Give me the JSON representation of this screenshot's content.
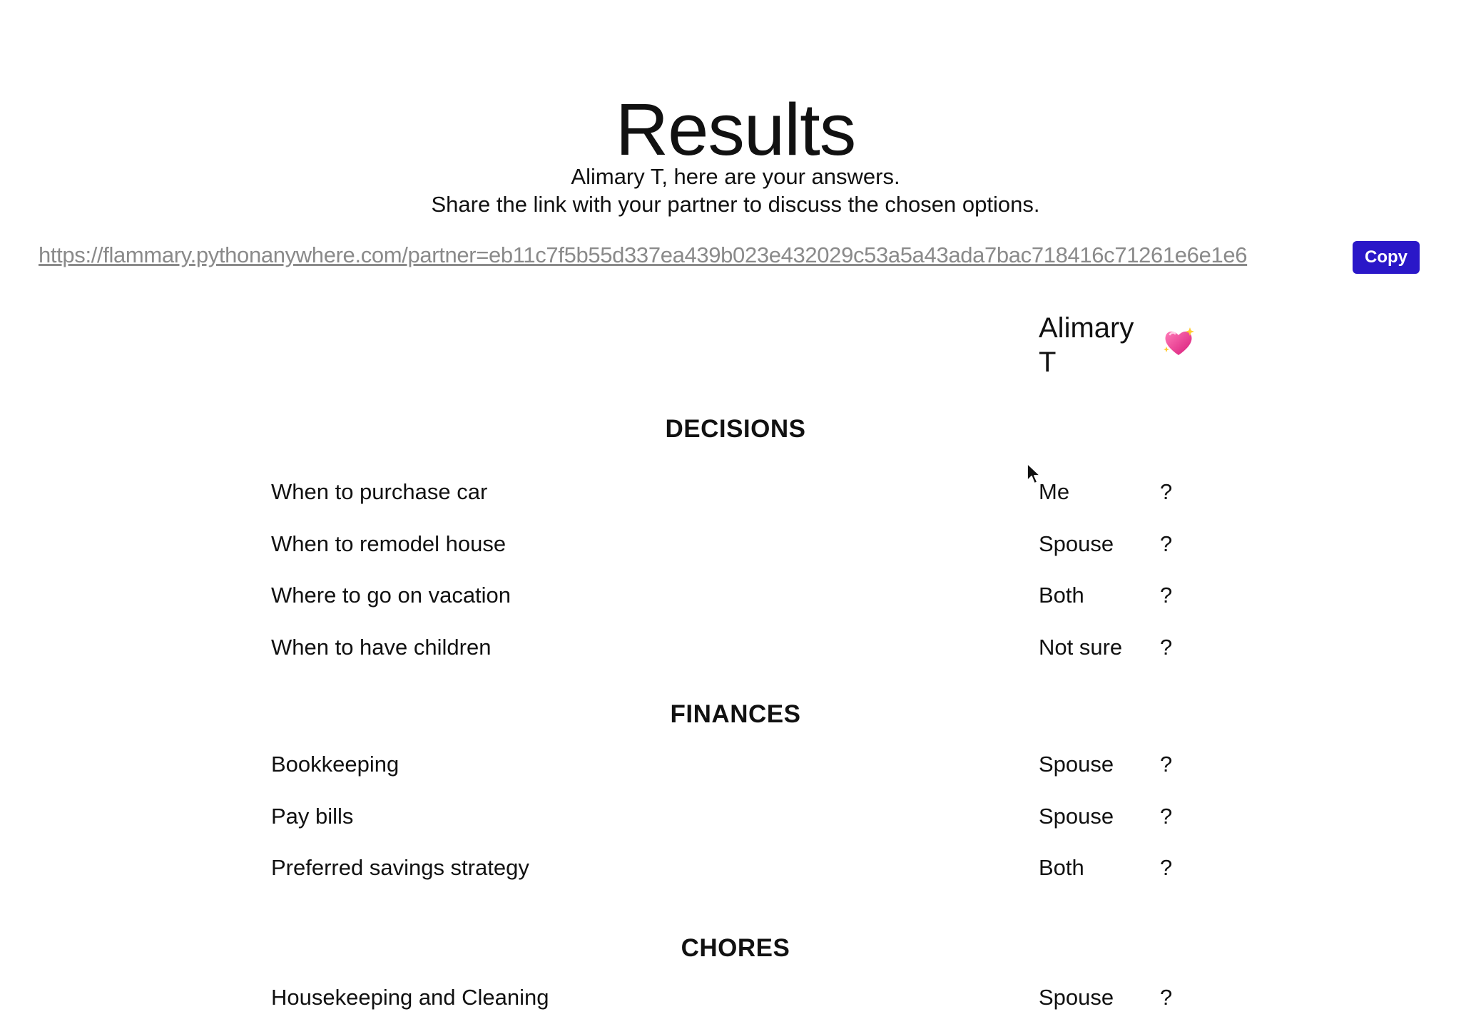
{
  "page": {
    "title": "Results"
  },
  "intro": {
    "line1": "Alimary T, here are your answers.",
    "line2": "Share the link with your partner to discuss the chosen options."
  },
  "share": {
    "url": "https://flammary.pythonanywhere.com/partner=eb11c7f5b55d337ea439b023e432029c53a5a43ada7bac718416c71261e6e1e6",
    "copy_label": "Copy",
    "copy_color": "#2a17c8"
  },
  "table_header": {
    "user_name": "Alimary T",
    "partner_icon": "sparkling-heart-icon"
  },
  "sections": [
    {
      "heading": "DECISIONS",
      "rows": [
        {
          "label": "When to purchase car",
          "answer": "Me",
          "partner": "?"
        },
        {
          "label": "When to remodel house",
          "answer": "Spouse",
          "partner": "?"
        },
        {
          "label": "Where to go on vacation",
          "answer": "Both",
          "partner": "?"
        },
        {
          "label": "When to have children",
          "answer": "Not sure",
          "partner": "?"
        }
      ]
    },
    {
      "heading": "FINANCES",
      "rows": [
        {
          "label": "Bookkeeping",
          "answer": "Spouse",
          "partner": "?"
        },
        {
          "label": "Pay bills",
          "answer": "Spouse",
          "partner": "?"
        },
        {
          "label": "Preferred savings strategy",
          "answer": "Both",
          "partner": "?"
        }
      ]
    },
    {
      "heading": "CHORES",
      "rows": [
        {
          "label": "Housekeeping and Cleaning",
          "answer": "Spouse",
          "partner": "?"
        }
      ]
    }
  ]
}
